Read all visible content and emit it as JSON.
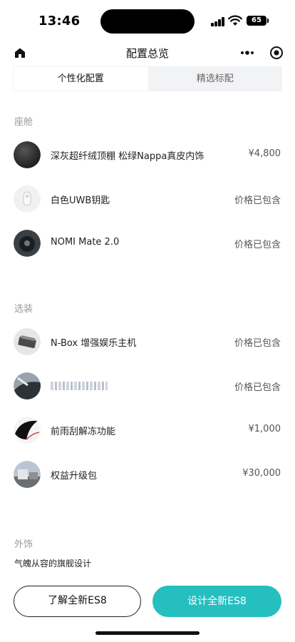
{
  "status": {
    "time": "13:46",
    "battery": "65"
  },
  "nav": {
    "title": "配置总览"
  },
  "tabs": [
    {
      "label": "个性化配置"
    },
    {
      "label": "精选标配"
    }
  ],
  "sections": {
    "cabin": {
      "label": "座舱",
      "items": [
        {
          "name": "深灰超纤绒顶棚 松绿Nappa真皮内饰",
          "price": "¥4,800"
        },
        {
          "name": "白色UWB钥匙",
          "price": "价格已包含"
        },
        {
          "name": "NOMI Mate 2.0",
          "price": "价格已包含"
        }
      ]
    },
    "options": {
      "label": "选装",
      "items": [
        {
          "name": "N-Box 增强娱乐主机",
          "price": "价格已包含"
        },
        {
          "name": "",
          "price": "价格已包含"
        },
        {
          "name": "前雨刮解冻功能",
          "price": "¥1,000"
        },
        {
          "name": "权益升级包",
          "price": "¥30,000"
        }
      ]
    },
    "exterior": {
      "label": "外饰",
      "desc": "气魄从容的旗舰设计"
    }
  },
  "buttons": {
    "learn": "了解全新ES8",
    "design": "设计全新ES8"
  },
  "colors": {
    "accent": "#25bfc0"
  }
}
